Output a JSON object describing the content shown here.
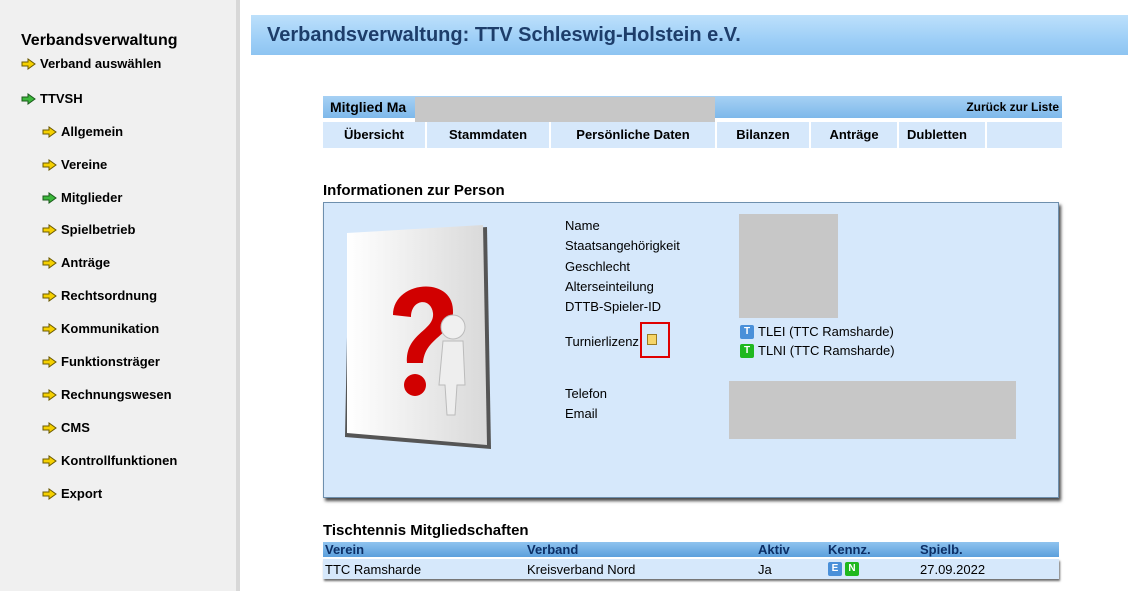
{
  "sidebar": {
    "title": "Verbandsverwaltung",
    "items": [
      {
        "label": "Verband auswählen",
        "active": false
      },
      {
        "label": "TTVSH",
        "active": true
      },
      {
        "label": "Allgemein",
        "active": false
      },
      {
        "label": "Vereine",
        "active": false
      },
      {
        "label": "Mitglieder",
        "active": true
      },
      {
        "label": "Spielbetrieb",
        "active": false
      },
      {
        "label": "Anträge",
        "active": false
      },
      {
        "label": "Rechtsordnung",
        "active": false
      },
      {
        "label": "Kommunikation",
        "active": false
      },
      {
        "label": "Funktionsträger",
        "active": false
      },
      {
        "label": "Rechnungswesen",
        "active": false
      },
      {
        "label": "CMS",
        "active": false
      },
      {
        "label": "Kontrollfunktionen",
        "active": false
      },
      {
        "label": "Export",
        "active": false
      }
    ]
  },
  "header": {
    "title": "Verbandsverwaltung: TTV Schleswig-Holstein e.V."
  },
  "member": {
    "title_prefix": "Mitglied Ma",
    "back_link": "Zurück zur Liste",
    "tabs": [
      "Übersicht",
      "Stammdaten",
      "Persönliche Daten",
      "Bilanzen",
      "Anträge",
      "Dubletten"
    ]
  },
  "info": {
    "section_title": "Informationen zur Person",
    "labels": {
      "name": "Name",
      "citizenship": "Staatsangehörigkeit",
      "gender": "Geschlecht",
      "age_class": "Alterseinteilung",
      "player_id": "DTTB-Spieler-ID",
      "tournament_license": "Turnierlizenz",
      "phone": "Telefon",
      "email": "Email"
    },
    "licenses": [
      {
        "badge": "T",
        "color": "#4a90d9",
        "text": "TLEI (TTC Ramsharde)"
      },
      {
        "badge": "T",
        "color": "#1fb81f",
        "text": "TLNI (TTC Ramsharde)"
      }
    ]
  },
  "memberships": {
    "section_title": "Tischtennis Mitgliedschaften",
    "columns": [
      "Verein",
      "Verband",
      "Aktiv",
      "Kennz.",
      "Spielb."
    ],
    "rows": [
      {
        "verein": "TTC Ramsharde",
        "verband": "Kreisverband Nord",
        "aktiv": "Ja",
        "kennz": [
          {
            "letter": "E",
            "color": "#4a90d9"
          },
          {
            "letter": "N",
            "color": "#1fb81f"
          }
        ],
        "spielb": "27.09.2022"
      }
    ]
  },
  "colors": {
    "arrow": "#f5d000",
    "arrow_active": "#3cb83c",
    "highlight": "#e00000"
  }
}
